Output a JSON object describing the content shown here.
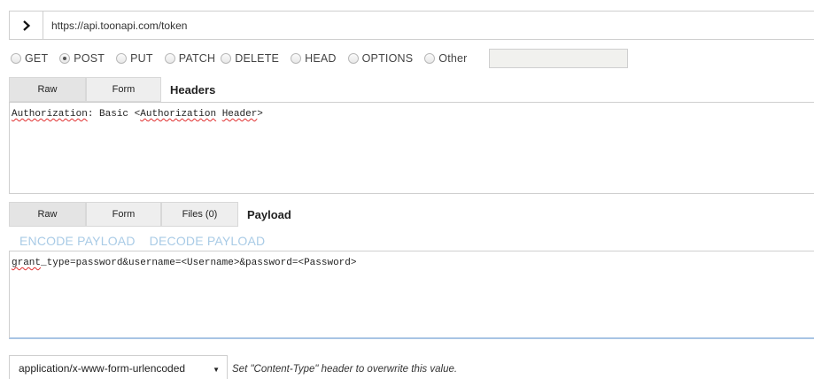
{
  "url_bar": {
    "toggle_icon": "chevron-right-icon",
    "url": "https://api.toonapi.com/token"
  },
  "methods": [
    {
      "label": "GET",
      "selected": false
    },
    {
      "label": "POST",
      "selected": true
    },
    {
      "label": "PUT",
      "selected": false
    },
    {
      "label": "PATCH",
      "selected": false
    },
    {
      "label": "DELETE",
      "selected": false
    },
    {
      "label": "HEAD",
      "selected": false
    },
    {
      "label": "OPTIONS",
      "selected": false
    },
    {
      "label": "Other",
      "selected": false
    }
  ],
  "headers_section": {
    "tabs": {
      "raw": "Raw",
      "form": "Form"
    },
    "title": "Headers",
    "body": {
      "w1": "Authorization",
      "t1": ": Basic <",
      "w2": "Authorization",
      "t2": " ",
      "w3": "Header",
      "t3": ">"
    }
  },
  "payload_section": {
    "tabs": {
      "raw": "Raw",
      "form": "Form",
      "files": "Files (0)"
    },
    "title": "Payload",
    "encode": "ENCODE PAYLOAD",
    "decode": "DECODE PAYLOAD",
    "body": {
      "w1": "grant",
      "t1": "_type=password&username=<Username>&password=<Password>"
    }
  },
  "content_type": {
    "selected": "application/x-www-form-urlencoded",
    "hint": "Set \"Content-Type\" header to overwrite this value."
  },
  "colors": {
    "link": "#a9cbe6",
    "tab_bg": "#e4e4e4",
    "border": "#cfcfcf",
    "payload_focus": "#a8c4e4"
  }
}
